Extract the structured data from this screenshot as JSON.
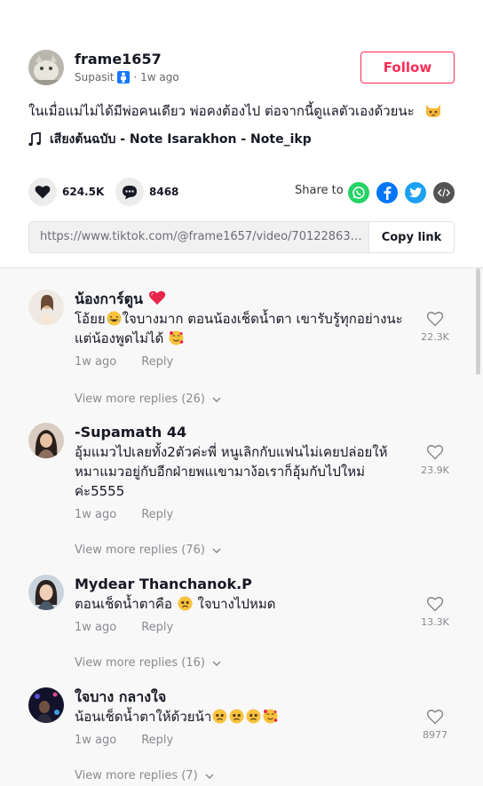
{
  "author": {
    "username": "frame1657",
    "nickname": "Supasit",
    "posted": "· 1w ago",
    "follow_label": "Follow"
  },
  "caption": "ในเมื่อแม่ไม่ได้มีพ่อคนเดียว พ่อคงต้องไป ต่อจากนี้ดูแลตัวเองด้วยนะ",
  "music": "เสียงต้นฉบับ - Note Isarakhon - Note_ikp",
  "actions": {
    "likes": "624.5K",
    "comments": "8468",
    "share_to": "Share to"
  },
  "link": {
    "url": "https://www.tiktok.com/@frame1657/video/7012286342310...",
    "copy_label": "Copy link"
  },
  "comments": [
    {
      "name": "น้องการ์ตูน",
      "text": "โอ้ยย",
      "text2": "ใจบางมาก ตอนน้องเช็ดน้ำตา เขารับรู้ทุกอย่างนะ แต่น้องพูดไม่ได้",
      "time": "1w ago",
      "reply": "Reply",
      "likes": "22.3K",
      "more": "View more replies (26)"
    },
    {
      "name": "-Supamath 44",
      "text": "อุ้มแมวไปเลยทั้ง2ตัวค่ะพี่ หนูเลิกกับแฟนไม่เคยปล่อยให้หมาแมวอยู่กับอีกฝ่ายพแเขามาง้อเราก็อุ้มกับไปใหม่ ค่ะ5555",
      "time": "1w ago",
      "reply": "Reply",
      "likes": "23.9K",
      "more": "View more replies (76)"
    },
    {
      "name": "Mydear Thanchanok.P",
      "text": "ตอนเช็ดน้ำตาคือ",
      "text2": "ใจบางไปหมด",
      "time": "1w ago",
      "reply": "Reply",
      "likes": "13.3K",
      "more": "View more replies (16)"
    },
    {
      "name": "ใจบาง กลางใจ",
      "text": "น้อนเช็ดน้ำตาให้ด้วยน้า",
      "time": "1w ago",
      "reply": "Reply",
      "likes": "8977",
      "more": "View more replies (7)"
    }
  ],
  "colors": {
    "accent": "#fe2c55",
    "whatsapp": "#25d366",
    "facebook": "#0075fa",
    "twitter": "#1da1f2",
    "embed": "#545454"
  }
}
